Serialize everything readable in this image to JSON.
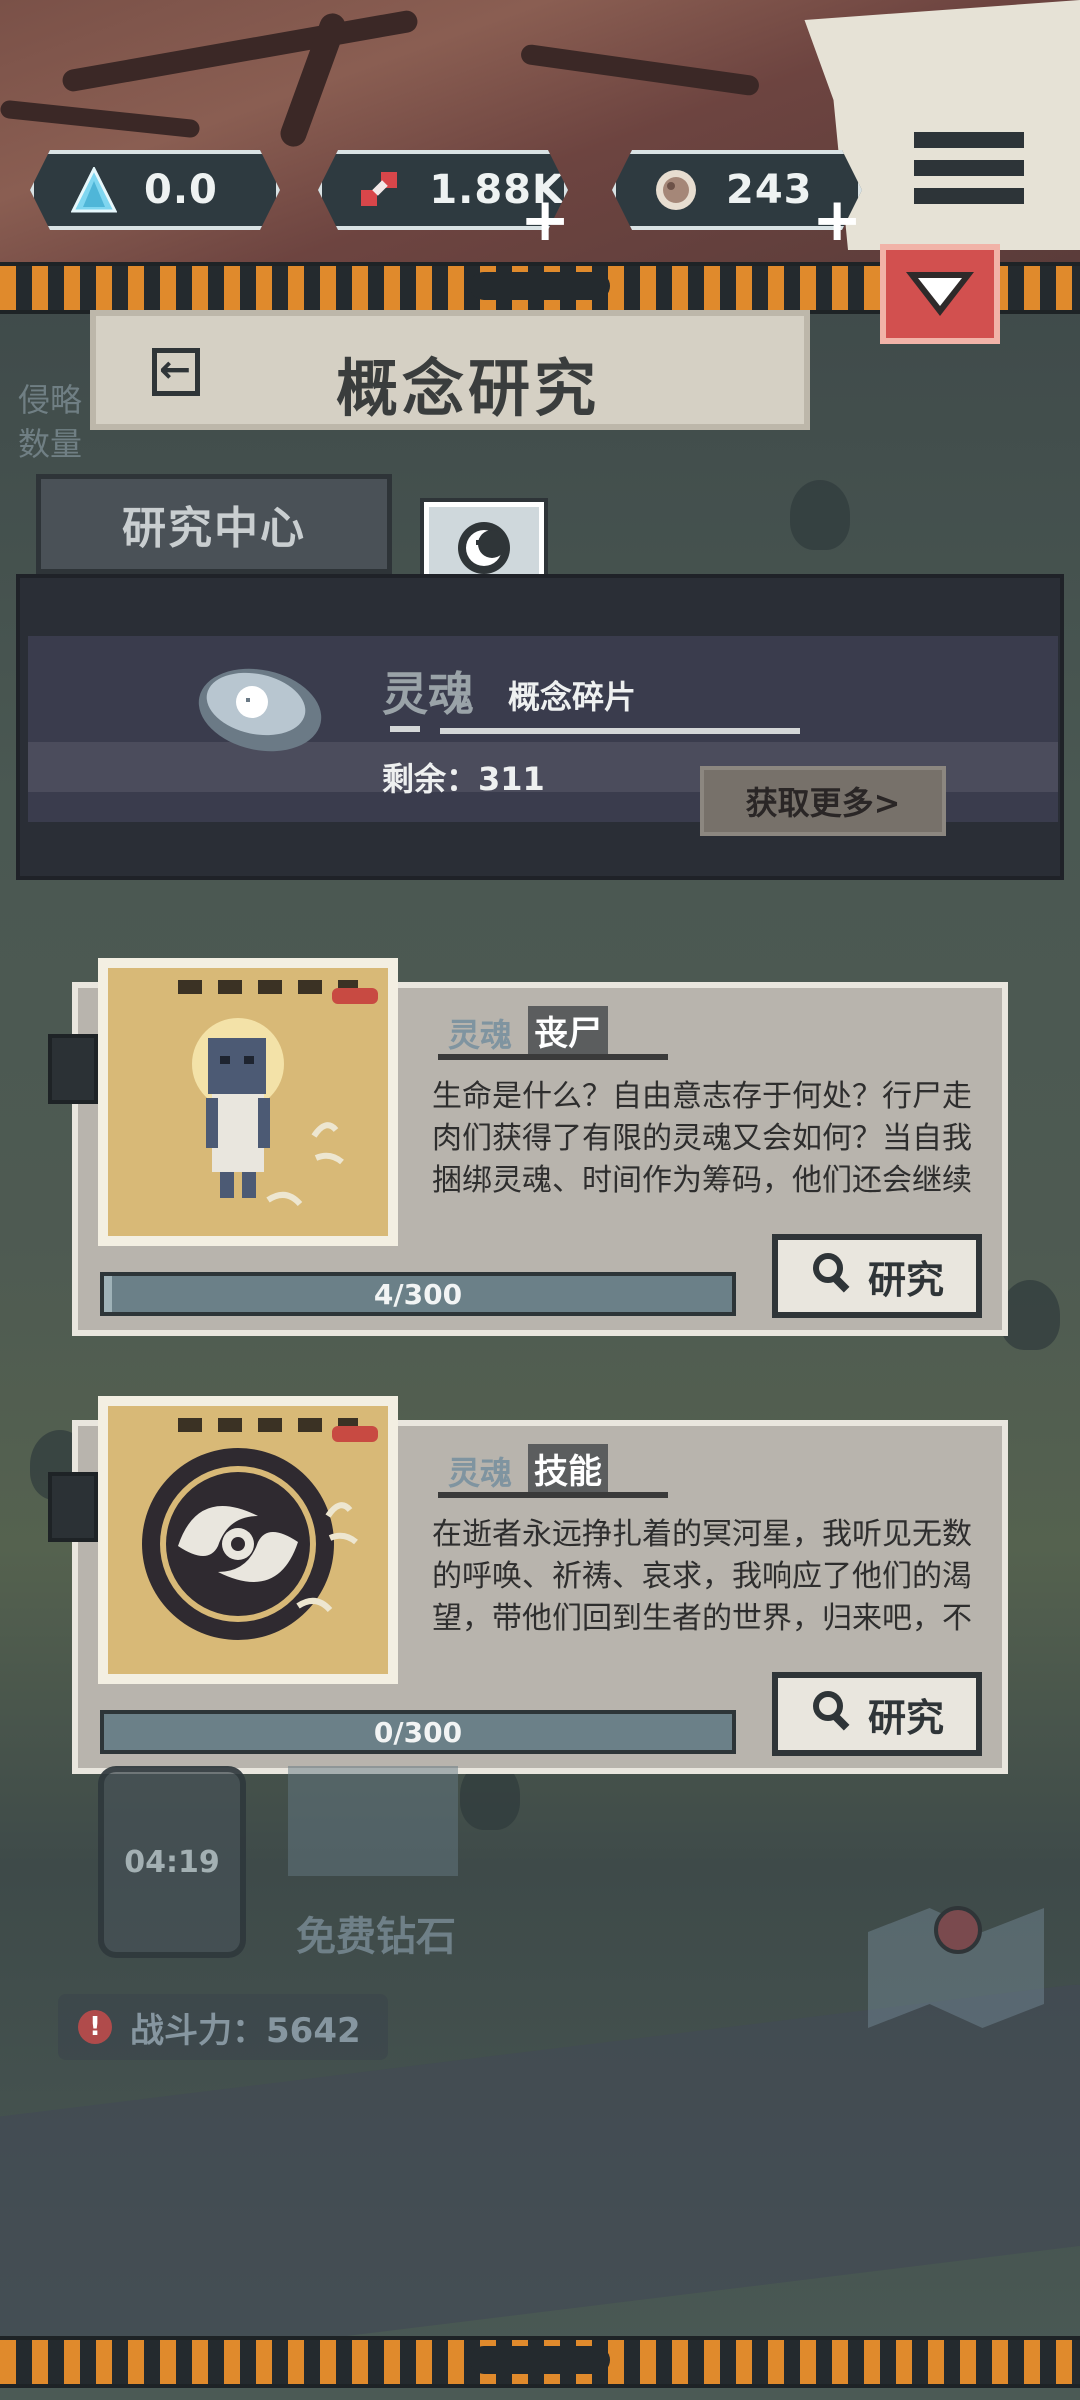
{
  "resources": [
    {
      "name": "triangle-gem",
      "value": "0.0",
      "has_plus": false
    },
    {
      "name": "dna",
      "value": "1.88K",
      "has_plus": true
    },
    {
      "name": "brain",
      "value": "243",
      "has_plus": true
    }
  ],
  "header": {
    "title": "概念研究",
    "side_hint": [
      "侵略",
      "数量"
    ]
  },
  "tabs": {
    "research_center": "研究中心"
  },
  "fragment": {
    "name": "灵魂",
    "subtitle": "概念碎片",
    "remaining": "剩余：311",
    "get_more": "获取更多>"
  },
  "cards": [
    {
      "tag": "灵魂",
      "type": "丧尸",
      "description": "生命是什么？自由意志存于何处？行尸走肉们获得了有限的灵魂又会如何？当自我捆绑灵魂、时间作为筹码，他们还会继续无畏战斗吗？",
      "progress_current": 4,
      "progress_max": 300,
      "progress_text": "4/300",
      "button": "研究"
    },
    {
      "tag": "灵魂",
      "type": "技能",
      "description": "在逝者永远挣扎着的冥河星，我听见无数的呼唤、祈祷、哀求，我响应了他们的渴望，带他们回到生者的世界，归来吧，不甘的灵魂。",
      "progress_current": 0,
      "progress_max": 300,
      "progress_text": "0/300",
      "button": "研究"
    }
  ],
  "background": {
    "timer": "04:19",
    "free_diamond": "免费钻石",
    "power": "战斗力：5642"
  },
  "colors": {
    "hazard_orange": "#e08a2c",
    "collapse_red": "#d2504f",
    "card_bg": "#b8b4ad",
    "panel_dark": "#2a2e36"
  }
}
